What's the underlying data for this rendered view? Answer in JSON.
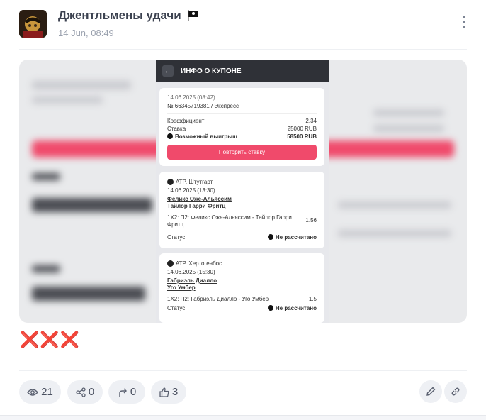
{
  "post": {
    "channel_name": "Джентльмены удачи",
    "timestamp": "14 Jun, 08:49",
    "caption": "❌❌❌"
  },
  "coupon": {
    "header": "ИНФО О КУПОНЕ",
    "date_time": "14.06.2025 (08:42)",
    "number": "№ 66345719381 / Экспресс",
    "coef_label": "Коэффициент",
    "coef_value": "2.34",
    "stake_label": "Ставка",
    "stake_value": "25000 RUB",
    "win_label": "Возможный выигрыш",
    "win_value": "58500 RUB",
    "repeat_button": "Повторить ставку",
    "events": [
      {
        "tournament": "ATP. Штутгарт",
        "date": "14.06.2025 (13:30)",
        "player1": "Феликс Оже-Альяссим",
        "player2": "Тайлор Гарри Фритц",
        "bet": "1X2: П2: Феликс Оже-Альяссим - Тайлор Гарри Фритц",
        "odds": "1.56",
        "status_label": "Статус",
        "status_value": "Не рассчитано"
      },
      {
        "tournament": "ATP. Хертогенбос",
        "date": "14.06.2025 (15:30)",
        "player1": "Габриэль Диалло",
        "player2": "Уго Умбер",
        "bet": "1X2: П2: Габриэль Диалло - Уго Умбер",
        "odds": "1.5",
        "status_label": "Статус",
        "status_value": "Не рассчитано"
      }
    ]
  },
  "stats": {
    "views": "21",
    "shares": "0",
    "forwards": "0",
    "likes": "3"
  },
  "colors": {
    "accent_red": "#f04a6b",
    "pill_bg": "#eef0f4",
    "cross_red": "#e8473a"
  }
}
